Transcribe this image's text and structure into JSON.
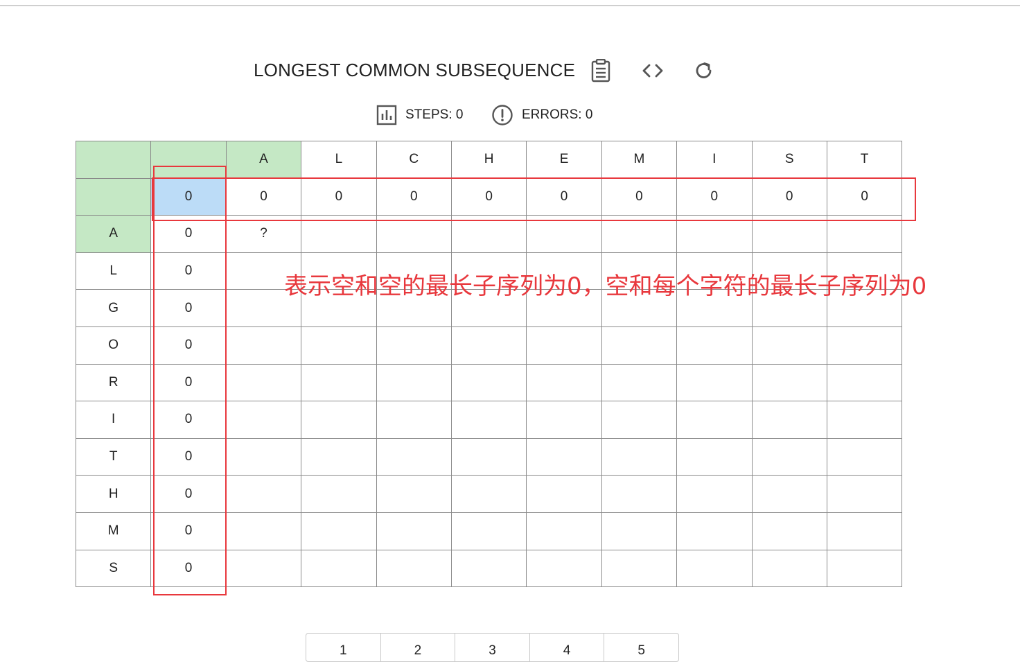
{
  "header": {
    "title": "LONGEST COMMON SUBSEQUENCE",
    "icons": [
      "clipboard-icon",
      "code-icon",
      "refresh-icon"
    ]
  },
  "stats": {
    "steps_label": "STEPS: 0",
    "errors_label": "ERRORS: 0"
  },
  "grid": {
    "corner": [
      "",
      ""
    ],
    "top_string": [
      "A",
      "L",
      "C",
      "H",
      "E",
      "M",
      "I",
      "S",
      "T"
    ],
    "left_string": [
      "A",
      "L",
      "G",
      "O",
      "R",
      "I",
      "T",
      "H",
      "M",
      "S"
    ],
    "rows": [
      [
        "0",
        "0",
        "0",
        "0",
        "0",
        "0",
        "0",
        "0",
        "0",
        "0"
      ],
      [
        "0",
        "?",
        "",
        "",
        "",
        "",
        "",
        "",
        "",
        ""
      ],
      [
        "0",
        "",
        "",
        "",
        "",
        "",
        "",
        "",
        "",
        ""
      ],
      [
        "0",
        "",
        "",
        "",
        "",
        "",
        "",
        "",
        "",
        ""
      ],
      [
        "0",
        "",
        "",
        "",
        "",
        "",
        "",
        "",
        "",
        ""
      ],
      [
        "0",
        "",
        "",
        "",
        "",
        "",
        "",
        "",
        "",
        ""
      ],
      [
        "0",
        "",
        "",
        "",
        "",
        "",
        "",
        "",
        "",
        ""
      ],
      [
        "0",
        "",
        "",
        "",
        "",
        "",
        "",
        "",
        "",
        ""
      ],
      [
        "0",
        "",
        "",
        "",
        "",
        "",
        "",
        "",
        "",
        ""
      ],
      [
        "0",
        "",
        "",
        "",
        "",
        "",
        "",
        "",
        "",
        ""
      ],
      [
        "0",
        "",
        "",
        "",
        "",
        "",
        "",
        "",
        "",
        ""
      ]
    ]
  },
  "annotation": {
    "text": "表示空和空的最长子序列为0，空和每个字符的最长子序列为0",
    "color": "#e8383d"
  },
  "pagination": {
    "pages": [
      "1",
      "2",
      "3",
      "4",
      "5"
    ]
  },
  "colors": {
    "header_green": "#c5e8c5",
    "active_blue": "#bcdcf7",
    "annotation_red": "#e8383d"
  }
}
